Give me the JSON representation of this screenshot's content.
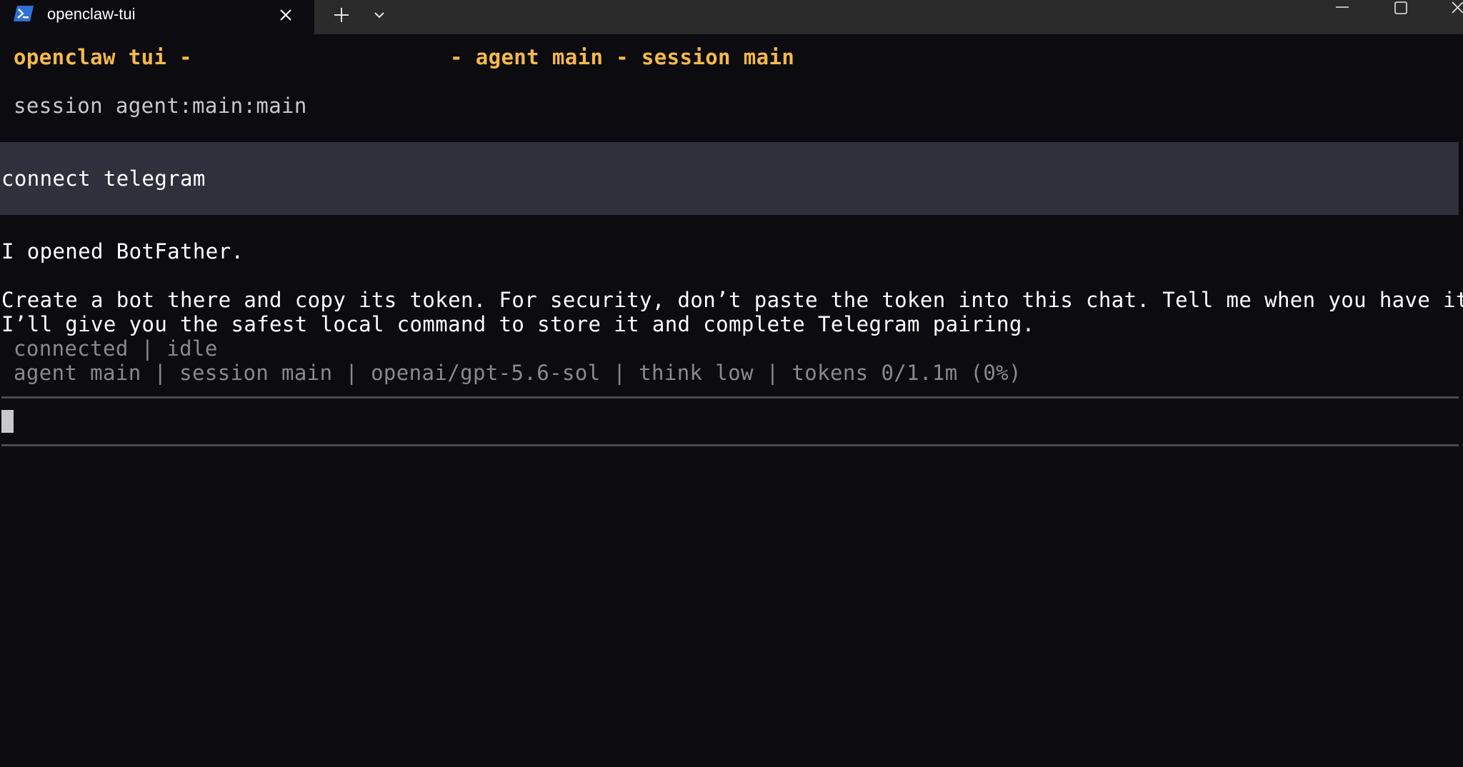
{
  "window": {
    "tab_title": "openclaw-tui",
    "icons": {
      "tab_icon": "powershell-icon",
      "tab_close": "close-icon",
      "new_tab": "plus-icon",
      "tab_menu": "chevron-down-icon",
      "minimize": "minimize-icon",
      "maximize": "maximize-icon",
      "close": "close-icon"
    }
  },
  "terminal": {
    "header_left": "openclaw tui -",
    "header_right": "- agent main - session main",
    "session_line": "session agent:main:main",
    "user_message": "connect telegram",
    "reply_lines": [
      "I opened BotFather.",
      "Create a bot there and copy its token. For security, don’t paste the token into this chat. Tell me when you have it, and",
      "I’ll give you the safest local command to store it and complete Telegram pairing."
    ],
    "status_connection": "connected | idle",
    "status_info": "agent main | session main | openai/gpt-5.6-sol | think low | tokens 0/1.1m (0%)",
    "input_value": ""
  },
  "colors": {
    "background": "#0c0b0f",
    "header_accent": "#f5b94a",
    "user_message_bg": "#2e313c",
    "status_text": "#8a8a8e",
    "titlebar": "#2b2b2b"
  }
}
